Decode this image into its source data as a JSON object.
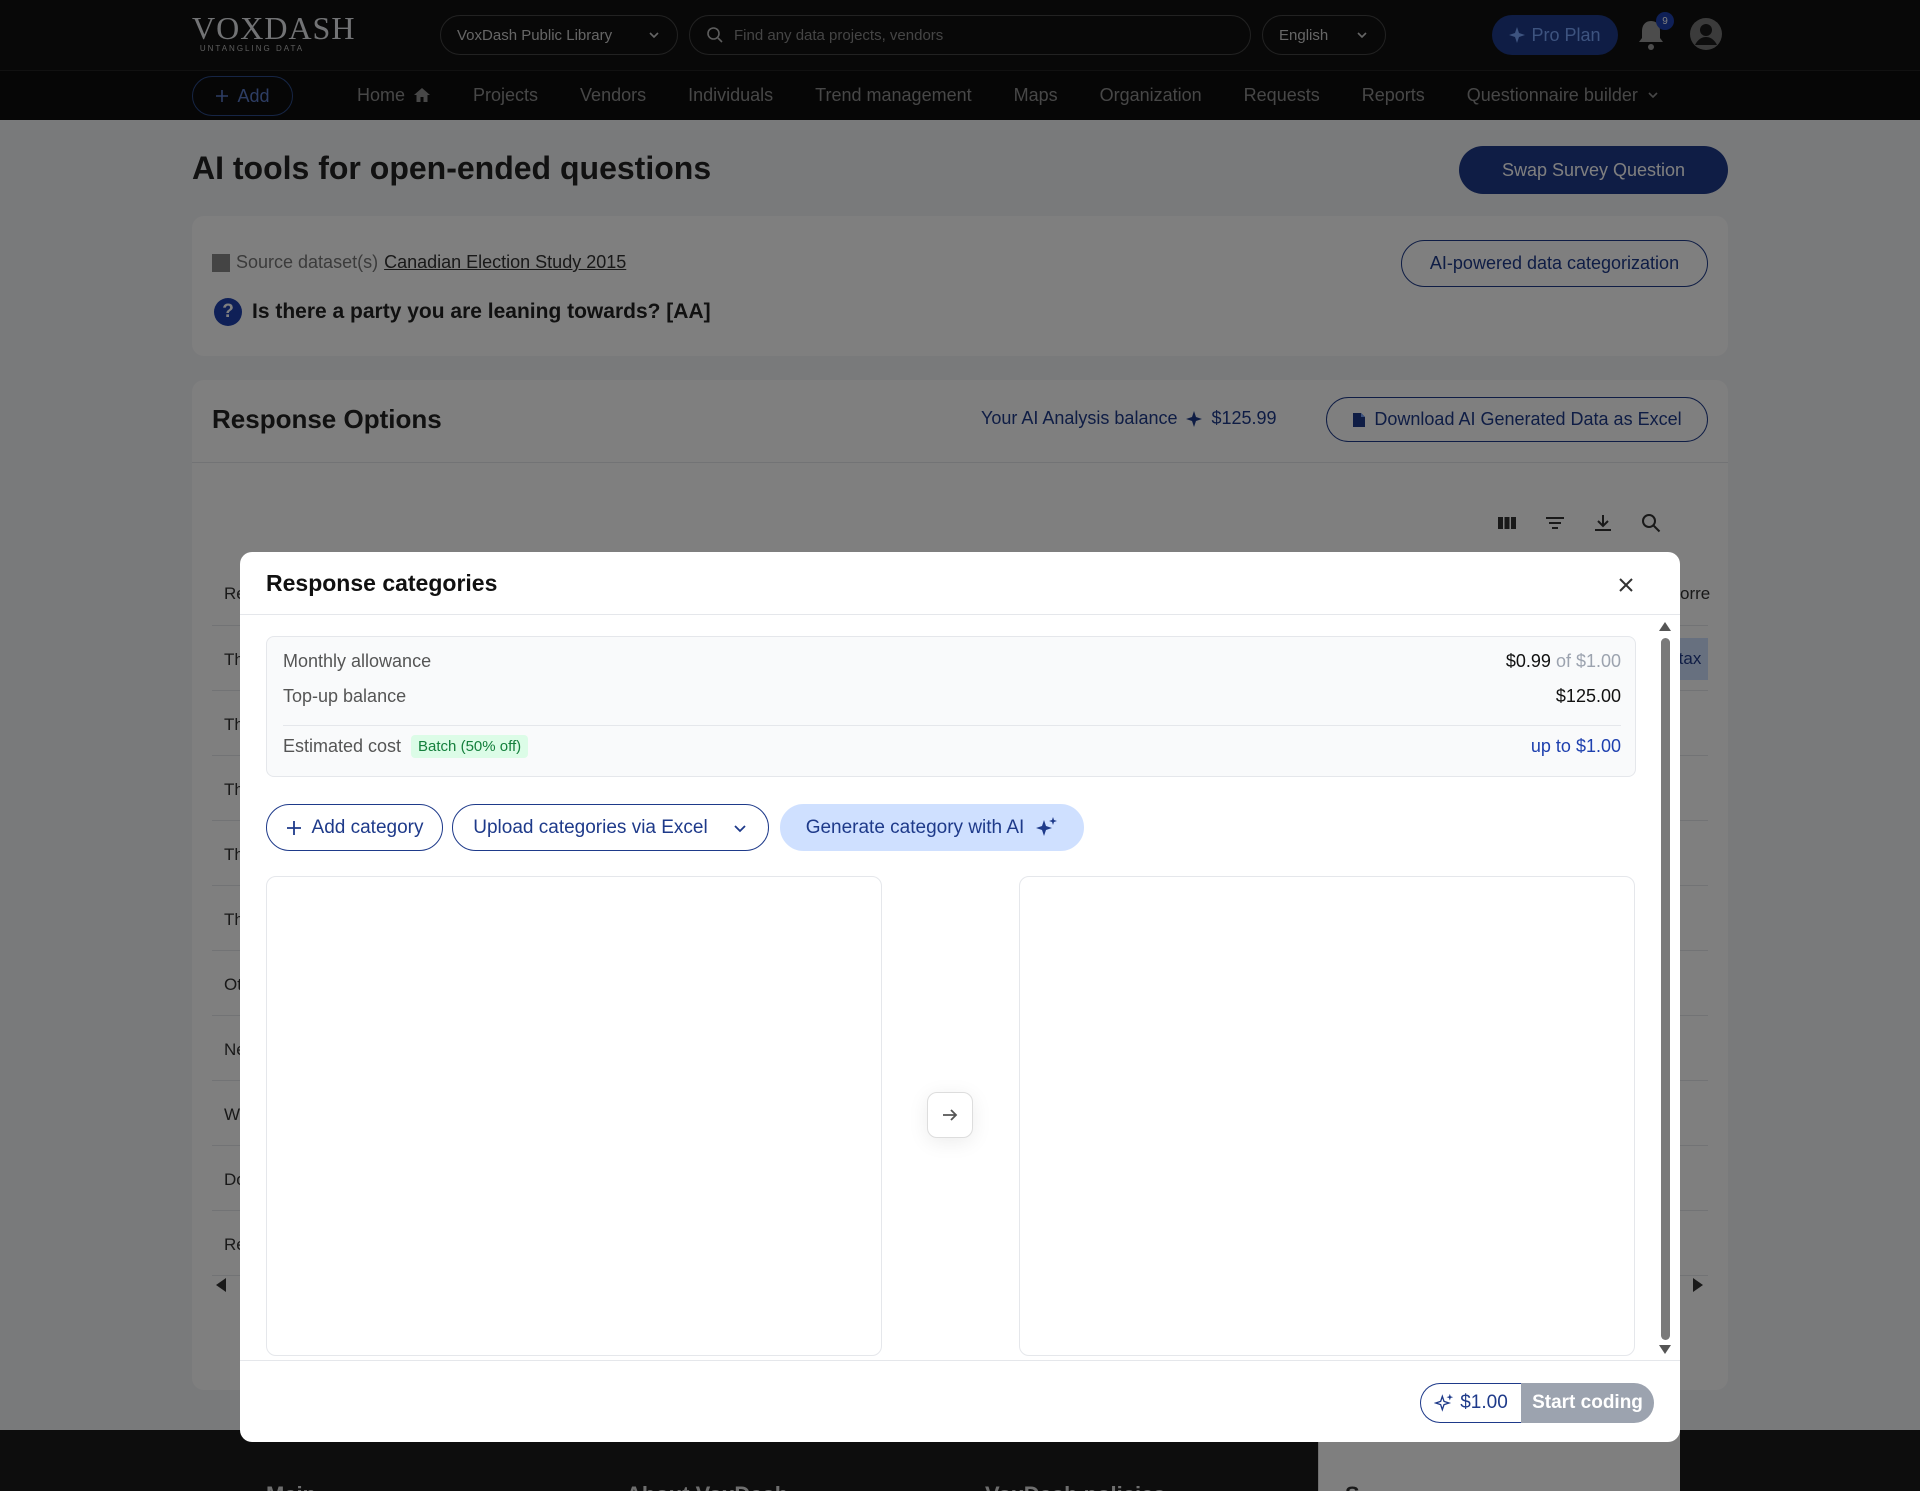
{
  "header": {
    "logo_text": "VOXDASH",
    "logo_tagline": "UNTANGLING DATA",
    "library_select": "VoxDash Public Library",
    "search_placeholder": "Find any data projects, vendors",
    "language_select": "English",
    "pro_plan_label": "Pro Plan",
    "notification_count": "9"
  },
  "nav": {
    "add_label": "Add",
    "items": [
      "Home",
      "Projects",
      "Vendors",
      "Individuals",
      "Trend management",
      "Maps",
      "Organization",
      "Requests",
      "Reports",
      "Questionnaire builder"
    ]
  },
  "page": {
    "title": "AI tools for open-ended questions",
    "swap_button": "Swap Survey Question",
    "source_label": "Source dataset(s)",
    "source_link": "Canadian Election Study 2015",
    "ai_categorization_button": "AI-powered data categorization",
    "question_icon": "?",
    "question": "Is there a party you are leaning towards? [AA]",
    "response_options_title": "Response Options",
    "balance_label": "Your AI Analysis balance",
    "balance_value": "$125.99",
    "download_button": "Download AI Generated Data as Excel",
    "table_col_left_fragment": "Re",
    "table_col_right_fragment": "orre",
    "row_fragments": [
      "Th",
      "Th",
      "Th",
      "Th",
      "Th",
      "Ot",
      "Ne",
      "W",
      "Do",
      "Re"
    ],
    "right_chip_fragment": "tax"
  },
  "modal": {
    "title": "Response categories",
    "monthly_allowance_label": "Monthly allowance",
    "monthly_allowance_value": "$0.99",
    "monthly_allowance_of": "of $1.00",
    "topup_label": "Top-up balance",
    "topup_value": "$125.00",
    "estimated_cost_label": "Estimated cost",
    "batch_badge": "Batch (50% off)",
    "estimated_cost_value": "up to $1.00",
    "add_category_button": "Add category",
    "upload_button": "Upload categories via Excel",
    "generate_button": "Generate category with AI",
    "footer_cost": "$1.00",
    "start_button": "Start coding"
  },
  "footer": {
    "columns": [
      "Main",
      "About VoxDash",
      "VoxDash policies",
      "S"
    ]
  },
  "colors": {
    "brand_navy": "#1e3a8a",
    "accent_blue": "#1e40af",
    "ai_light_blue": "#cfe0ff",
    "batch_green": "#15803d"
  }
}
